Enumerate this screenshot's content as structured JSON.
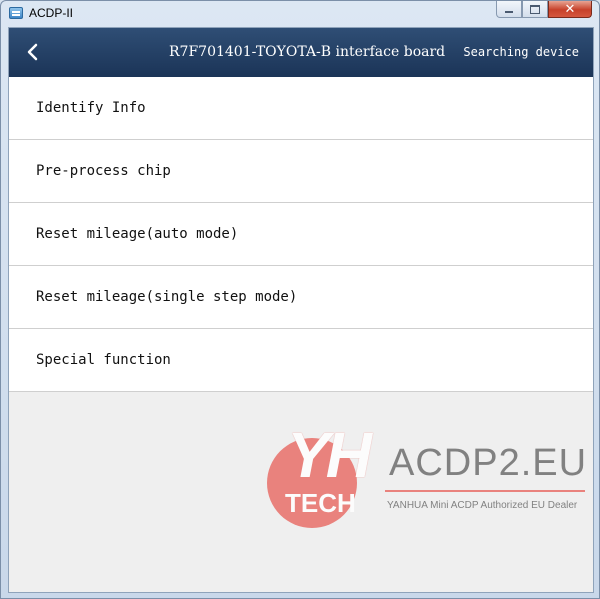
{
  "window": {
    "title": "ACDP-II",
    "controls": {
      "close_glyph": "✕"
    }
  },
  "header": {
    "title": "R7F701401-TOYOTA-B interface board",
    "status": "Searching device"
  },
  "menu": {
    "items": [
      {
        "label": "Identify Info"
      },
      {
        "label": "Pre-process chip"
      },
      {
        "label": "Reset mileage(auto mode)"
      },
      {
        "label": "Reset mileage(single step mode)"
      },
      {
        "label": "Special function"
      }
    ]
  },
  "watermark": {
    "logo_text": "YH",
    "logo_sub": "TECH",
    "site": "ACDP2.EU",
    "tagline": "YANHUA Mini ACDP Authorized EU Dealer"
  },
  "colors": {
    "header_bg": "#1f3a60",
    "watermark_accent": "#e8706a"
  },
  "icons": {
    "back": "chevron-left-icon",
    "app": "app-icon"
  }
}
